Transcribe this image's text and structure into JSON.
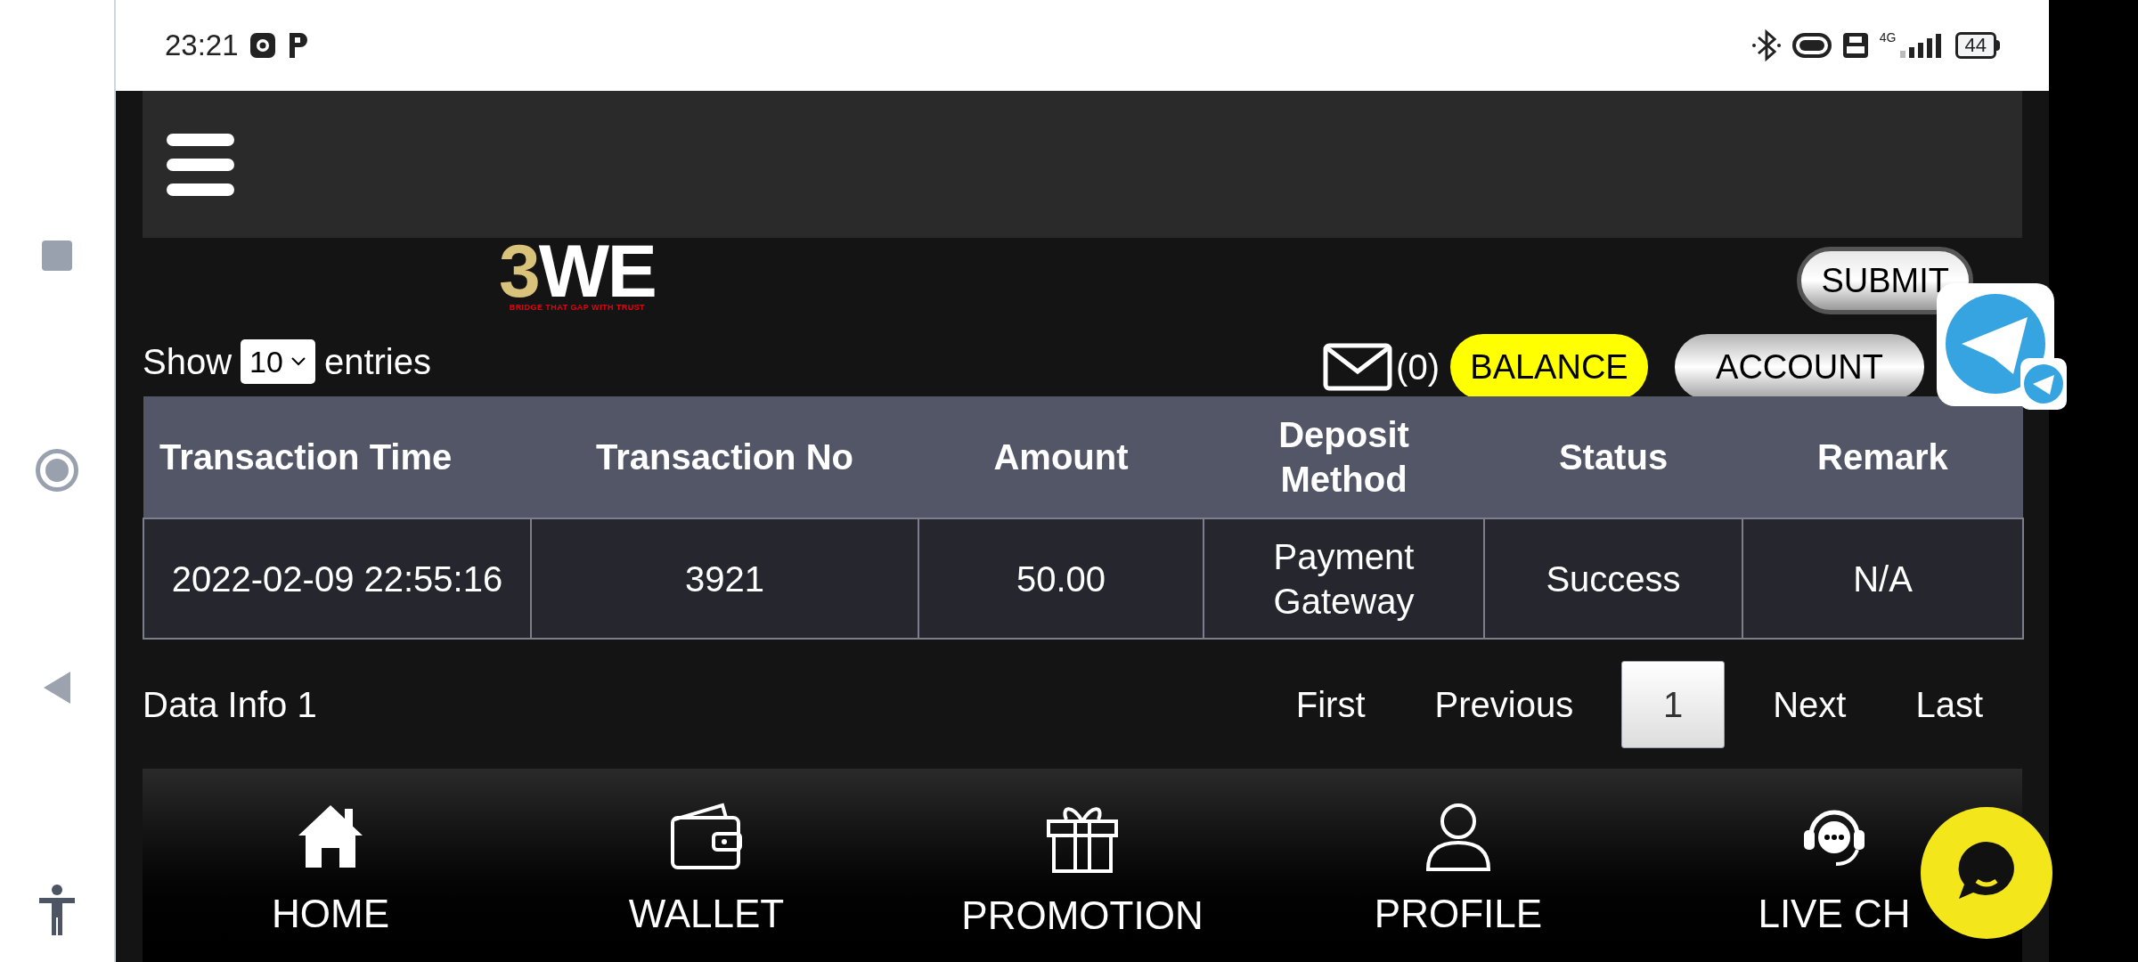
{
  "status_bar": {
    "time": "23:21",
    "network": "4G",
    "battery": "44"
  },
  "logo": {
    "wordmark_lead": "3",
    "wordmark_rest": "WE",
    "tagline": "BRIDGE THAT GAP WITH TRUST"
  },
  "submit_button": "SUBMIT",
  "length_menu": {
    "before": "Show",
    "value": "10",
    "after": "entries"
  },
  "inbox_count": "(0)",
  "balance_button": "BALANCE",
  "account_button": "ACCOUNT",
  "table": {
    "columns": [
      "Transaction Time",
      "Transaction No",
      "Amount",
      "Deposit Method",
      "Status",
      "Remark"
    ],
    "rows": [
      [
        "2022-02-09 22:55:16",
        "3921",
        "50.00",
        "Payment Gateway",
        "Success",
        "N/A"
      ]
    ]
  },
  "info": "Data Info 1",
  "pagination": [
    {
      "label": "First",
      "selected": false
    },
    {
      "label": "Previous",
      "selected": false
    },
    {
      "label": "1",
      "selected": true
    },
    {
      "label": "Next",
      "selected": false
    },
    {
      "label": "Last",
      "selected": false
    }
  ],
  "bottom_nav": [
    {
      "label": "HOME",
      "kind": "home"
    },
    {
      "label": "WALLET",
      "kind": "wallet"
    },
    {
      "label": "PROMOTION",
      "kind": "gift"
    },
    {
      "label": "PROFILE",
      "kind": "person"
    },
    {
      "label": "LIVE CH",
      "kind": "headset"
    }
  ]
}
